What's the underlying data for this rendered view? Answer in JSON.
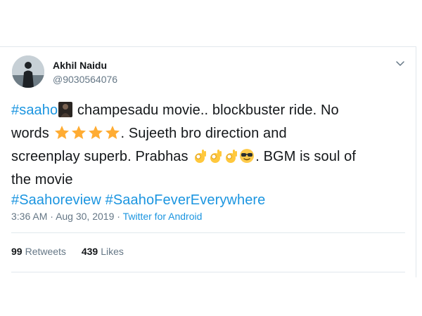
{
  "user": {
    "name": "Akhil Naidu",
    "handle": "@9030564076"
  },
  "tweet": {
    "hashtag_saaho": "#saaho",
    "text1": " champesadu movie.. blockbuster ride. No",
    "text2": "words ",
    "text3": ". Sujeeth bro direction and",
    "text4": "screenplay superb. Prabhas ",
    "text5": ". BGM is soul of",
    "text6": "the movie",
    "hashtag_review": "#Saahoreview",
    "hashtag_fever": "#SaahoFeverEverywhere",
    "icons": [
      "person-photo-icon",
      "star-icon",
      "star-icon",
      "star-icon",
      "star-icon",
      "ok-hand-icon",
      "ok-hand-icon",
      "ok-hand-icon",
      "sunglasses-face-icon"
    ]
  },
  "meta": {
    "time": "3:36 AM",
    "separator": "·",
    "date": "Aug 30, 2019",
    "source": "Twitter for Android"
  },
  "stats": {
    "retweets_count": "99",
    "retweets_label": "Retweets",
    "likes_count": "439",
    "likes_label": "Likes"
  },
  "colors": {
    "link": "#1b95e0",
    "secondary_text": "#657786",
    "border": "#e1e8ed",
    "star": "#ffac33"
  }
}
